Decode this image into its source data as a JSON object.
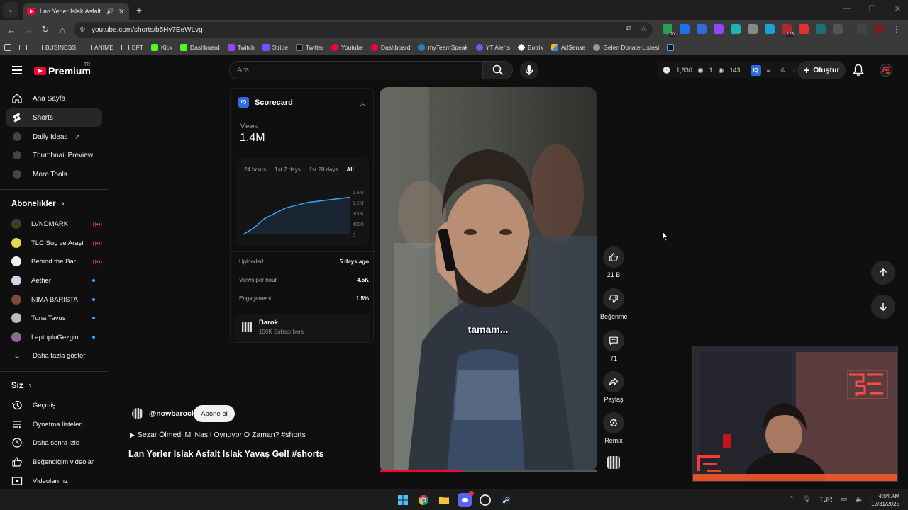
{
  "browser": {
    "tab_title": "Lan Yerler Islak Asfalt Islak Yavaş Gel! #shorts - YouTube",
    "url": "youtube.com/shorts/b5Hv7EeWLvg",
    "ext_badge_1": "10",
    "ext_badge_2": "125"
  },
  "bookmarks": [
    {
      "label": "BUSINESS",
      "type": "folder"
    },
    {
      "label": "ANIME",
      "type": "folder"
    },
    {
      "label": "EFT",
      "type": "folder"
    },
    {
      "label": "Kick",
      "color": "#53fc18"
    },
    {
      "label": "Dashboard",
      "color": "#53fc18"
    },
    {
      "label": "Twitch",
      "color": "#9146ff"
    },
    {
      "label": "Stripe",
      "color": "#635bff"
    },
    {
      "label": "Twitter",
      "color": "#222222"
    },
    {
      "label": "Youtube",
      "color": "#ff0033"
    },
    {
      "label": "Dashboard",
      "color": "#ff0033"
    },
    {
      "label": "myTeamSpeak",
      "color": "#2580c3"
    },
    {
      "label": "YT Alerts",
      "color": "#5865f2"
    },
    {
      "label": "Botrix",
      "color": "#ffffff"
    },
    {
      "label": "AdSense",
      "color": "#fbbc04"
    },
    {
      "label": "Gelen Donate Listesi",
      "color": "#aaaaaa"
    }
  ],
  "header": {
    "logo_text": "Premium",
    "logo_region": "TR",
    "search_placeholder": "Ara",
    "stats": {
      "clock_count": "1,630",
      "eye_count_a": "1",
      "eye_count_b": "143"
    },
    "create_label": "Oluştur"
  },
  "sidebar": {
    "main": [
      {
        "label": "Ana Sayfa",
        "icon": "home-icon"
      },
      {
        "label": "Shorts",
        "icon": "shorts-icon",
        "active": true
      },
      {
        "label": "Daily Ideas",
        "icon": "vidiq-icon"
      },
      {
        "label": "Thumbnail Preview",
        "icon": "vidiq-icon"
      },
      {
        "label": "More Tools",
        "icon": "vidiq-icon"
      }
    ],
    "subs_heading": "Abonelikler",
    "subscriptions": [
      {
        "name": "LVNDMARK",
        "badge": "live",
        "color": "#3a3f2a"
      },
      {
        "name": "TLC Suç ve Araştırma",
        "badge": "live",
        "color": "#e8d84a"
      },
      {
        "name": "Behind the Bar",
        "badge": "live",
        "color": "#f2f2f2"
      },
      {
        "name": "Aether",
        "badge": "new",
        "color": "#cfd6e6"
      },
      {
        "name": "NIMA BARISTA",
        "badge": "new",
        "color": "#7a4a3a"
      },
      {
        "name": "Tuna Tavus",
        "badge": "new",
        "color": "#bbbbbb"
      },
      {
        "name": "LaptopluGezgin",
        "badge": "new",
        "color": "#8a6a8f"
      }
    ],
    "show_more": "Daha fazla göster",
    "you_heading": "Siz",
    "you": [
      {
        "label": "Geçmiş",
        "icon": "history-icon"
      },
      {
        "label": "Oynatma listeleri",
        "icon": "playlists-icon"
      },
      {
        "label": "Daha sonra izle",
        "icon": "watch-later-icon"
      },
      {
        "label": "Beğendiğim videolar",
        "icon": "liked-icon"
      },
      {
        "label": "Videolarınız",
        "icon": "your-videos-icon"
      }
    ]
  },
  "scorecard": {
    "title": "Scorecard",
    "views_label": "Views",
    "views_value": "1.4M",
    "tabs": [
      "24 hours",
      "1st 7 days",
      "1st 28 days",
      "All"
    ],
    "active_tab": "All",
    "y_ticks": [
      "1.6M",
      "1.2M",
      "800K",
      "400K",
      "0"
    ],
    "rows": [
      {
        "label": "Uploaded",
        "value": "5 days ago"
      },
      {
        "label": "Views per hour",
        "value": "4.5K"
      },
      {
        "label": "Engagement",
        "value": "1.5%"
      }
    ],
    "channel_name": "Barok",
    "channel_subs": "150K Subscribers"
  },
  "chart_data": {
    "type": "area",
    "title": "",
    "x": [
      0,
      1,
      2,
      3,
      4,
      5,
      6,
      7,
      8,
      9,
      10
    ],
    "values": [
      0,
      250000,
      600000,
      800000,
      1000000,
      1100000,
      1200000,
      1250000,
      1300000,
      1350000,
      1400000
    ],
    "ylim": [
      0,
      1600000
    ],
    "grid": false,
    "color": "#3ea6ff"
  },
  "video": {
    "subtitle": "tamam...",
    "progress": 0.38,
    "channel_handle": "@nowbarock",
    "subscribe_label": "Abone ol",
    "playlist_line": "Sezar Ölmedi Mi Nasıl Oynuyor O Zaman? #shorts",
    "title": "Lan Yerler Islak Asfalt Islak Yavaş Gel! #shorts"
  },
  "actions": {
    "like_count": "21 B",
    "dislike_label": "Beğenme",
    "comments_count": "71",
    "share_label": "Paylaş",
    "remix_label": "Remix"
  },
  "taskbar": {
    "language": "TUR",
    "time": "4:04 AM",
    "date": "12/31/2025"
  }
}
